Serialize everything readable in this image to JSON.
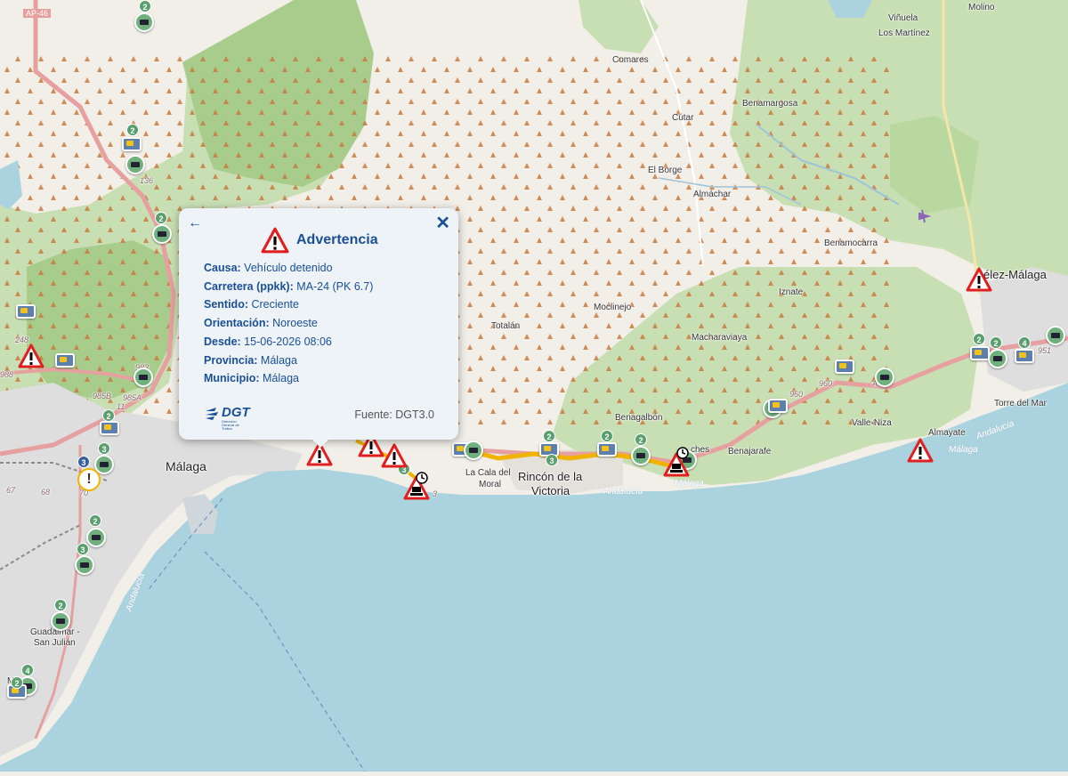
{
  "map": {
    "colors": {
      "land": "#f2efe9",
      "sea": "#aad3df",
      "forest": "#c8dfb4",
      "dense_forest": "#a8cc8c",
      "urban": "#dedede",
      "road": "#e6a0a0",
      "incident_route": "#f0b400"
    },
    "places": {
      "malaga": "Málaga",
      "rincon1": "Rincón de la",
      "rincon2": "Victoria",
      "cala1": "La Cala del",
      "cala2": "Moral",
      "totalan": "Totalán",
      "moclinejo": "Moclinejo",
      "macharaviaya": "Macharaviaya",
      "benagalbon": "Benagalbón",
      "iznate": "Iznate",
      "benamocarra": "Benamocarra",
      "velez": "élez-Málaga",
      "torre": "Torre del Mar",
      "vallen": "Valle-Niza",
      "almayate": "Almayate",
      "benajarafe": "Benajarafe",
      "chilches": "ches",
      "elborge": "El Borge",
      "almachar": "Almáchar",
      "cutar": "Cútar",
      "comares": "Comares",
      "benamargosa": "Benamargosa",
      "vinuela": "Viñuela",
      "losmartinez": "Los Martínez",
      "molino": "Molino",
      "guadalmar1": "Guadalmar -",
      "guadalmar2": "San Julián",
      "maza": "Máza",
      "ap46": "AP-46",
      "a7": "A-7",
      "r136": "136",
      "r248": "248",
      "r988": "988",
      "r985b": "985B",
      "r985a": "985A",
      "r983": "983",
      "r960a": "960",
      "r960b": "960",
      "r951": "951",
      "r68": "68",
      "r70": "70",
      "r67": "67",
      "r11": "11",
      "r32": "3",
      "coast_andalucia1": "Andalucía",
      "coast_malaga1": "Málaga",
      "coast_andalucia2": "Andalucía",
      "coast_malaga2": "Málaga",
      "coast_andalucia3": "Andalucía"
    },
    "badges": [
      "2",
      "2",
      "2",
      "2",
      "3",
      "3",
      "2",
      "3",
      "2",
      "2",
      "2",
      "2",
      "2",
      "4",
      "4",
      "3",
      "2",
      "2",
      "3"
    ],
    "info_marker": "!"
  },
  "popup": {
    "back_icon": "←",
    "close_icon": "✕",
    "title": "Advertencia",
    "rows": [
      {
        "label": "Causa:",
        "value": "Vehículo detenido"
      },
      {
        "label": "Carretera (ppkk):",
        "value": "MA-24 (PK 6.7)"
      },
      {
        "label": "Sentido:",
        "value": "Creciente"
      },
      {
        "label": "Orientación:",
        "value": "Noroeste"
      },
      {
        "label": "Desde:",
        "value": "15-06-2026 08:06"
      },
      {
        "label": "Provincia:",
        "value": "Málaga"
      },
      {
        "label": "Municipio:",
        "value": "Málaga"
      }
    ],
    "logo_text": "DGT",
    "logo_subtext": "Dirección General de Tráfico",
    "source": "Fuente: DGT3.0"
  }
}
